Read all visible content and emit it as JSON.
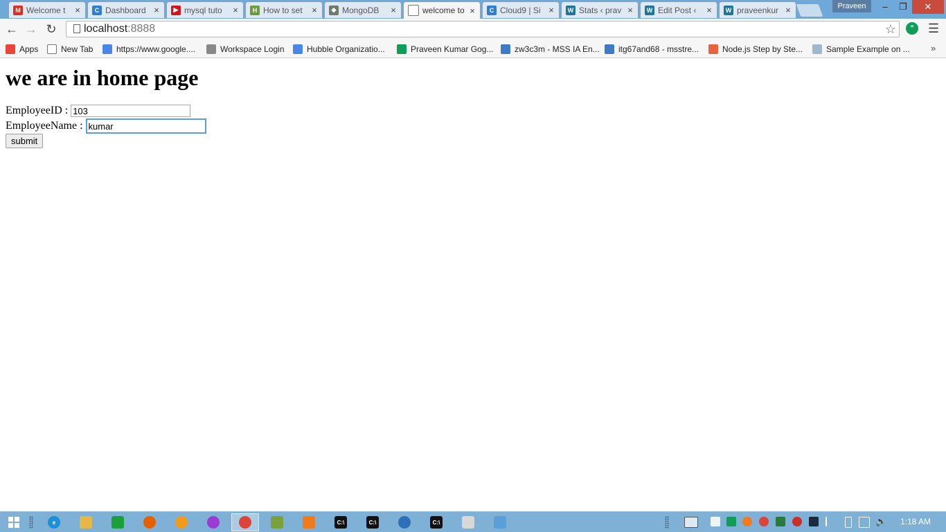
{
  "browser": {
    "tabs": [
      {
        "title": "Welcome t",
        "icon": "gmail-icon",
        "color": "#d93025",
        "glyph": "M"
      },
      {
        "title": "Dashboard",
        "icon": "cloud9-icon",
        "color": "#2f7fd1",
        "glyph": "C"
      },
      {
        "title": "mysql tuto",
        "icon": "youtube-icon",
        "color": "#cc181e",
        "glyph": "▶"
      },
      {
        "title": "How to set",
        "icon": "page-icon",
        "color": "#6c9a3f",
        "glyph": "H"
      },
      {
        "title": "MongoDB",
        "icon": "mongodb-icon",
        "color": "#6d7b6b",
        "glyph": "◆"
      },
      {
        "title": "welcome to",
        "icon": "blank-page-icon",
        "color": "#ffffff",
        "glyph": ""
      },
      {
        "title": "Cloud9 | Si",
        "icon": "cloud9-icon",
        "color": "#2f7fd1",
        "glyph": "C"
      },
      {
        "title": "Stats ‹ prav",
        "icon": "wordpress-icon",
        "color": "#21759b",
        "glyph": "W"
      },
      {
        "title": "Edit Post ‹",
        "icon": "wordpress-icon",
        "color": "#21759b",
        "glyph": "W"
      },
      {
        "title": "praveenkur",
        "icon": "wordpress-icon",
        "color": "#21759b",
        "glyph": "W"
      }
    ],
    "active_tab": 5,
    "profile_name": "Praveen",
    "url_host": "localhost",
    "url_port": ":8888",
    "bookmarks": [
      {
        "label": "Apps",
        "icon": "apps-grid-icon",
        "color": "#e8453c"
      },
      {
        "label": "New Tab",
        "icon": "page-icon",
        "color": "#ffffff"
      },
      {
        "label": "https://www.google....",
        "icon": "google-icon",
        "color": "#4a86e8"
      },
      {
        "label": "Workspace Login",
        "icon": "workspace-icon",
        "color": "#888888"
      },
      {
        "label": "Hubble Organizatio...",
        "icon": "google-icon",
        "color": "#4a86e8"
      },
      {
        "label": "Praveen Kumar Gog...",
        "icon": "sheets-icon",
        "color": "#0f9d58"
      },
      {
        "label": "zw3c3m - MSS IA En...",
        "icon": "trello-icon",
        "color": "#3d7bc4"
      },
      {
        "label": "itg67and68 - msstre...",
        "icon": "trello-icon",
        "color": "#3d7bc4"
      },
      {
        "label": "Node.js Step by Ste...",
        "icon": "plus-icon",
        "color": "#e8643c"
      },
      {
        "label": "Sample Example on ...",
        "icon": "cloud-icon",
        "color": "#9fb8cc"
      }
    ]
  },
  "page": {
    "heading": "we are in home page",
    "employee_id_label": "EmployeeID :",
    "employee_id_value": "103",
    "employee_name_label": "EmployeeName :",
    "employee_name_value": "kumar",
    "submit_label": "submit"
  },
  "taskbar": {
    "apps": [
      {
        "name": "ie-icon",
        "color": "#1e90d8",
        "glyph": "e"
      },
      {
        "name": "file-explorer-icon",
        "color": "#e6b84a",
        "glyph": ""
      },
      {
        "name": "green-app-icon",
        "color": "#1a9f3a",
        "glyph": ""
      },
      {
        "name": "firefox-icon",
        "color": "#e66000",
        "glyph": ""
      },
      {
        "name": "orange-orb-icon",
        "color": "#f39a1b",
        "glyph": ""
      },
      {
        "name": "purple-globe-icon",
        "color": "#9a3bd1",
        "glyph": ""
      },
      {
        "name": "chrome-icon",
        "color": "#db4437",
        "glyph": ""
      },
      {
        "name": "notepad-icon",
        "color": "#7aa23c",
        "glyph": ""
      },
      {
        "name": "flame-app-icon",
        "color": "#f07b1e",
        "glyph": ""
      },
      {
        "name": "cmd-icon",
        "color": "#111111",
        "glyph": "C:\\"
      },
      {
        "name": "cmd-icon",
        "color": "#111111",
        "glyph": "C:\\"
      },
      {
        "name": "blue-circle-app-icon",
        "color": "#2d6fb8",
        "glyph": ""
      },
      {
        "name": "cmd-icon",
        "color": "#111111",
        "glyph": "C:\\"
      },
      {
        "name": "document-app-icon",
        "color": "#d8d8d8",
        "glyph": ""
      },
      {
        "name": "paint-icon",
        "color": "#5aa0d6",
        "glyph": ""
      }
    ],
    "pressed_index": 6,
    "clock": "1:18 AM"
  }
}
